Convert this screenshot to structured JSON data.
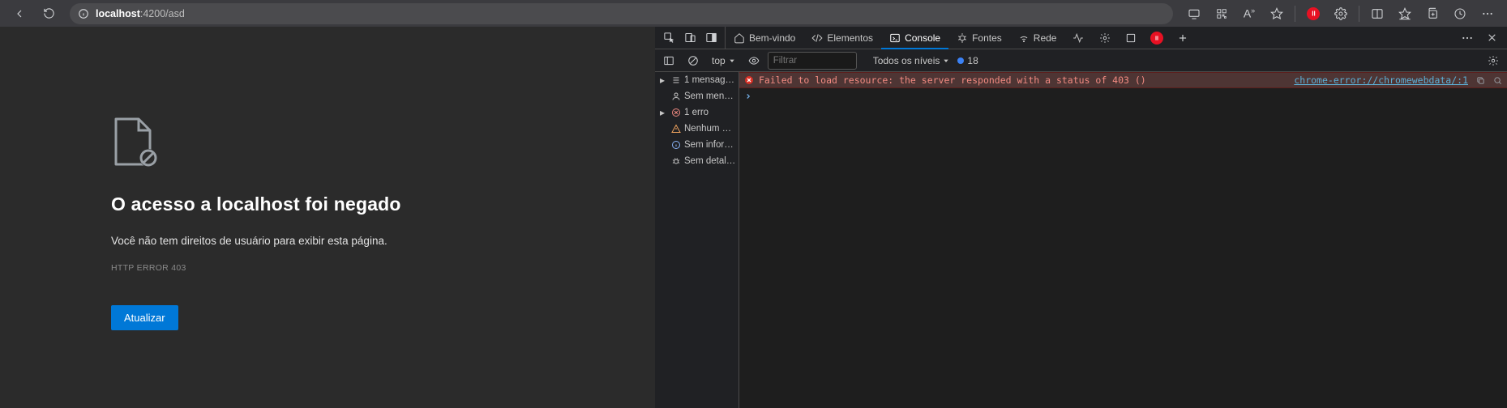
{
  "url": {
    "host": "localhost",
    "port_path": ":4200/asd"
  },
  "errorPage": {
    "title": "O acesso a localhost foi negado",
    "subtitle": "Você não tem direitos de usuário para exibir esta página.",
    "code": "HTTP ERROR 403",
    "reloadLabel": "Atualizar"
  },
  "devtools": {
    "tabs": {
      "welcome": "Bem-vindo",
      "elements": "Elementos",
      "console": "Console",
      "sources": "Fontes",
      "network": "Rede"
    },
    "activeTab": "console",
    "toolbar": {
      "context": "top",
      "filterPlaceholder": "Filtrar",
      "levelsLabel": "Todos os níveis",
      "issuesCount": "18"
    },
    "sidebar": {
      "messages": "1 mensag…",
      "noUser": "Sem men…",
      "errors": "1 erro",
      "noWarnings": "Nenhum …",
      "noInfo": "Sem infor…",
      "noVerbose": "Sem detal…"
    },
    "console": {
      "errorText": "Failed to load resource: the server responded with a status of 403 ()",
      "errorSource": "chrome-error://chromewebdata/:1"
    }
  }
}
